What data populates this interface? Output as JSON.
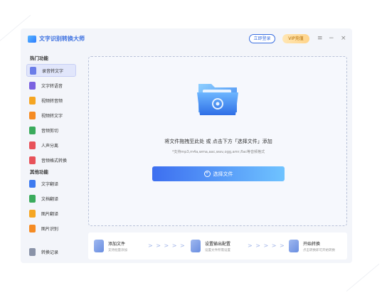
{
  "app": {
    "title": "文字识别转换大师"
  },
  "titlebar": {
    "login_label": "立即登录",
    "vip_label": "VIP充值",
    "menu_icon": "menu-icon",
    "minimize_icon": "minimize-icon",
    "close_icon": "close-icon"
  },
  "sidebar": {
    "section1": "热门功能",
    "section2": "其他功能",
    "items": [
      {
        "label": "录音转文字",
        "color": "#6a7de8"
      },
      {
        "label": "文字转语音",
        "color": "#7a62e0"
      },
      {
        "label": "视频转音频",
        "color": "#f5a623"
      },
      {
        "label": "视频转文字",
        "color": "#f58b23"
      },
      {
        "label": "音频剪切",
        "color": "#3aab5c"
      },
      {
        "label": "人声分离",
        "color": "#e8525a"
      },
      {
        "label": "音频格式转换",
        "color": "#e8525a"
      }
    ],
    "other_items": [
      {
        "label": "文字翻译",
        "color": "#3d7af0"
      },
      {
        "label": "文档翻译",
        "color": "#3aab5c"
      },
      {
        "label": "图片翻译",
        "color": "#f5a623"
      },
      {
        "label": "图片识别",
        "color": "#f58b23"
      }
    ],
    "history_label": "转换记录"
  },
  "main": {
    "drop_text": "将文件拖拽至此处 或 点击下方「选择文件」添加",
    "formats_text": "*支持mp3,m4a,wma,aac,wav,ogg,amr,flac等音频格式",
    "choose_label": "选择文件"
  },
  "steps": [
    {
      "title": "添加文件",
      "desc": "支持批量添加"
    },
    {
      "title": "设置输出配置",
      "desc": "设置文件所需设置"
    },
    {
      "title": "开始转换",
      "desc": "点击转换即可开始转换"
    }
  ],
  "arrows": "> > > > >"
}
